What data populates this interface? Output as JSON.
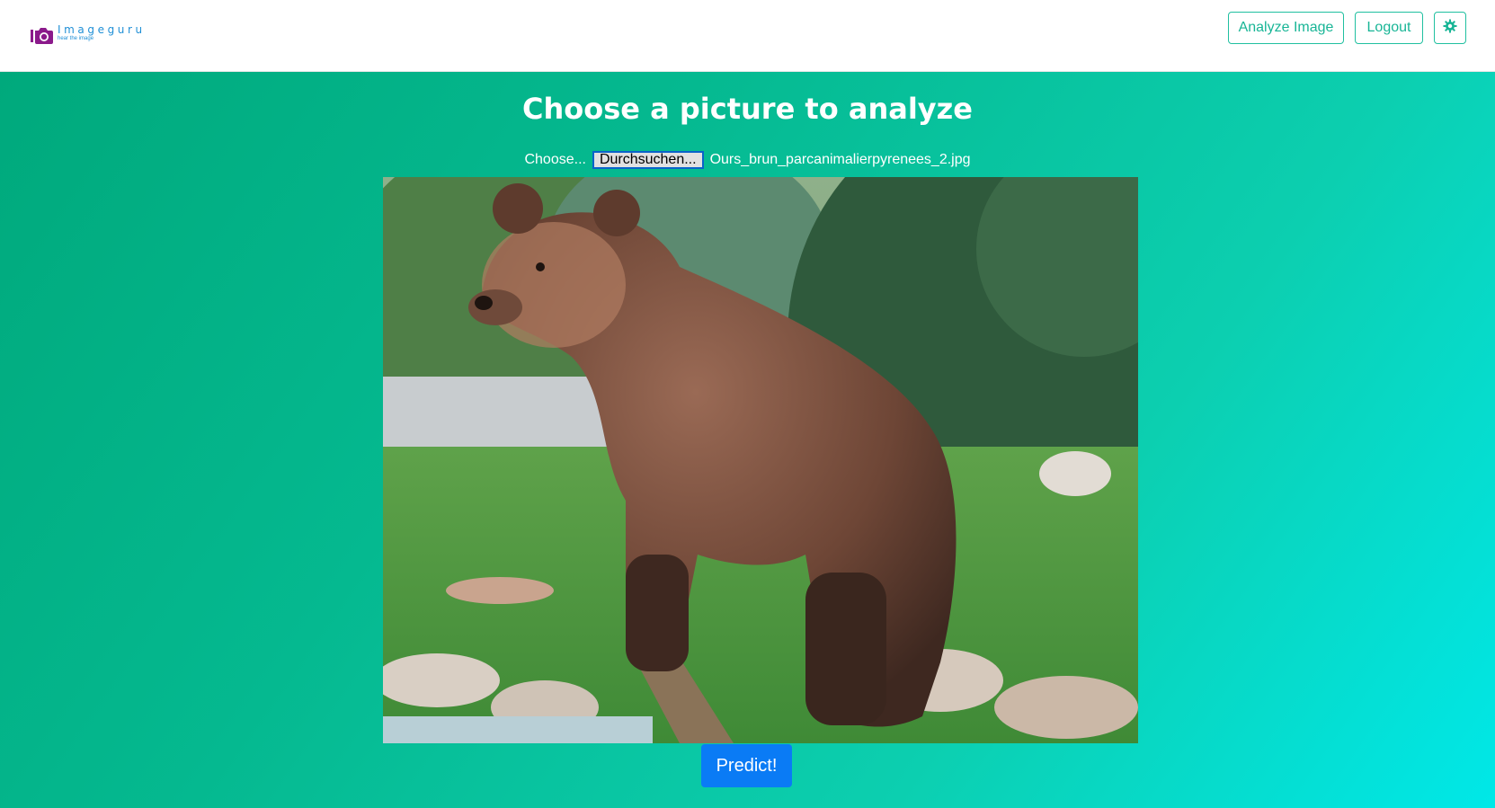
{
  "brand": {
    "name": "Imageguru",
    "tagline": "hear the image"
  },
  "nav": {
    "analyze_label": "Analyze Image",
    "logout_label": "Logout",
    "settings_icon": "gear-icon"
  },
  "main": {
    "title": "Choose a picture to analyze",
    "file_label": "Choose...",
    "browse_label": "Durchsuchen...",
    "file_name": "Ours_brun_parcanimalierpyrenees_2.jpg",
    "predict_label": "Predict!"
  },
  "colors": {
    "accent": "#20c0a0",
    "primary": "#0a7bf5",
    "logo": "#8b1a8b",
    "brand_text": "#1f8fd6"
  }
}
